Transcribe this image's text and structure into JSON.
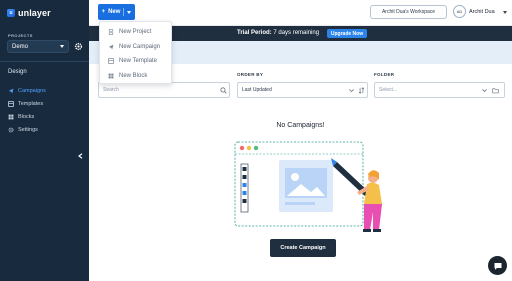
{
  "app": {
    "logo_text": "unlayer"
  },
  "sidebar": {
    "projects_label": "PROJECTS",
    "project_value": "Demo",
    "section_heading": "Design",
    "items": [
      {
        "label": "Campaigns",
        "icon": "send-icon",
        "active": true
      },
      {
        "label": "Templates",
        "icon": "template-icon",
        "active": false
      },
      {
        "label": "Blocks",
        "icon": "block-icon",
        "active": false
      },
      {
        "label": "Settings",
        "icon": "gear-icon",
        "active": false
      }
    ]
  },
  "topbar": {
    "new_label": "New",
    "workspace_label": "Archit Dua's Workspace",
    "avatar_initials": "AD",
    "user_name": "Archit Dua"
  },
  "banner": {
    "trial_label": "Trial Period:",
    "trial_text": "7 days remaining",
    "upgrade_label": "Upgrade Now"
  },
  "new_menu": {
    "items": [
      {
        "label": "New Project",
        "icon": "document-icon"
      },
      {
        "label": "New Campaign",
        "icon": "send-icon"
      },
      {
        "label": "New Template",
        "icon": "template-icon"
      },
      {
        "label": "New Block",
        "icon": "block-icon"
      }
    ]
  },
  "filters": {
    "search_placeholder": "Search",
    "order_label": "ORDER BY",
    "order_value": "Last Updated",
    "folder_label": "FOLDER",
    "folder_placeholder": "Select..."
  },
  "empty_state": {
    "title": "No Campaigns!",
    "create_label": "Create Campaign"
  },
  "colors": {
    "sidebar_bg": "#182a3e",
    "accent": "#1a6fe0",
    "banner_bg": "#1f2f40",
    "active_nav": "#4ea1ff"
  }
}
